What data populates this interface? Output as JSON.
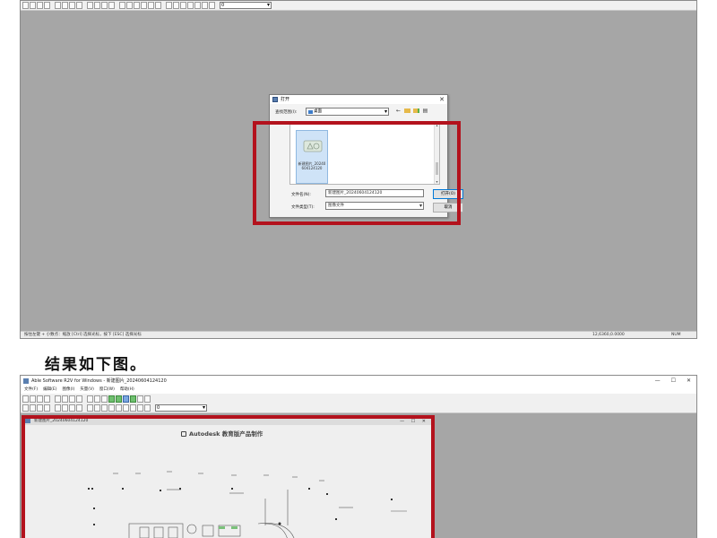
{
  "top": {
    "toolbar": {
      "combo_value": "0"
    },
    "status": {
      "left": "按住左键 + 小数点：缩放 [Ctrl] 选择光标，按下 [ESC] 选择光标",
      "coords": "12,6360,0.0000",
      "right": "NUM"
    },
    "dialog": {
      "title": "打开",
      "close_glyph": "✕",
      "lookin_label": "查找范围(I):",
      "lookin_value": "桌面",
      "file": {
        "name": "新建图片_20240604124120",
        "thumb_label": "DWG"
      },
      "filename_label": "文件名(N):",
      "filename_value": "新建图片_20240604124120",
      "filetype_label": "文件类型(T):",
      "filetype_value": "图像文件",
      "open_button": "打开(O)",
      "cancel_button": "取消"
    }
  },
  "caption": "结果如下图。",
  "bottom": {
    "window_title": "Able Software R2V for Windows - 新建图片_20240604124120",
    "window_controls": [
      "—",
      "☐",
      "✕"
    ],
    "menu": [
      "文件(F)",
      "编辑(E)",
      "图像(I)",
      "矢量(V)",
      "窗口(W)",
      "帮助(H)"
    ],
    "toolbar": {
      "combo_value": "0"
    },
    "document": {
      "title": "新建图片_20240604124120",
      "controls": "— ☐ ✕",
      "watermark": "Autodesk 教育版产品制作"
    }
  },
  "colors": {
    "highlight_red": "#b3121d",
    "workspace_gray": "#a6a6a6",
    "selection_blue": "#cfe3f7"
  }
}
